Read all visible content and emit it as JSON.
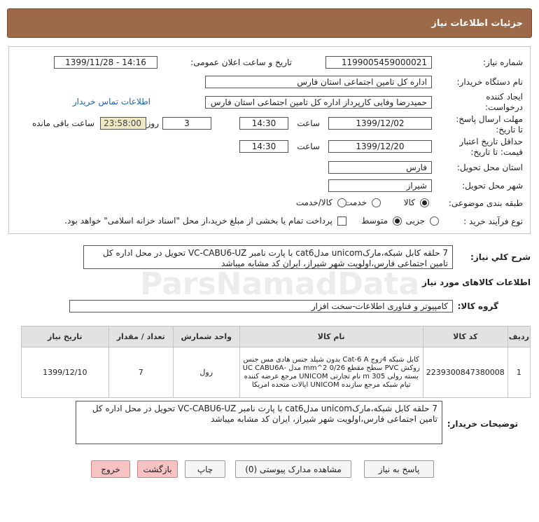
{
  "header": {
    "title": "جزئیات اطلاعات نیاز"
  },
  "fields": {
    "need_number_label": "شماره نیاز:",
    "need_number": "1199005459000021",
    "announce_label": "تاریخ و ساعت اعلان عمومی:",
    "announce_value": "1399/11/28 - 14:16",
    "buyer_org_label": "نام دستگاه خریدار:",
    "buyer_org": "اداره کل تامین اجتماعی استان فارس",
    "creator_label_1": "ایجاد کننده",
    "creator_label_2": "درخواست:",
    "creator": "حمیدرضا وفایی کارپرداز اداره کل تامین اجتماعی استان فارس",
    "contact_link": "اطلاعات تماس خریدار",
    "deadline_label_1": "مهلت ارسال پاسخ:",
    "deadline_label_2": "تا تاریخ:",
    "deadline_date": "1399/12/02",
    "time_label": "ساعت",
    "deadline_time": "14:30",
    "days": "3",
    "days_label": "روز و",
    "remaining_time": "23:58:00",
    "remaining_label": "ساعت باقی مانده",
    "validity_label_1": "حداقل تاریخ اعتبار",
    "validity_label_2": "قیمت: تا تاریخ:",
    "validity_date": "1399/12/20",
    "validity_time": "14:30",
    "province_label": "استان محل تحویل:",
    "province": "فارس",
    "city_label": "شهر محل تحویل:",
    "city": "شیراز",
    "category_label": "طبقه بندی موضوعی:",
    "category_options": [
      "کالا",
      "خدمت",
      "کالا/خدمت"
    ],
    "process_label": "نوع فرآیند خرید :",
    "process_options": [
      "جزیی",
      "متوسط"
    ],
    "payment_note": "پرداخت تمام یا بخشی از مبلغ خرید،از محل \"اسناد خزانه اسلامی\" خواهد بود."
  },
  "summary": {
    "label": "شرح کلي نياز:",
    "text": "7 حلقه کابل شبکه،مارکunicom مدلcat6 با پارت نامبر VC-CABU6-UZ تحویل در محل اداره کل تامین اجتماعی فارس،اولویت شهر شیراز، ایران کد مشابه میباشد"
  },
  "goods_section": {
    "title": "اطلاعات کالاهای مورد نیاز"
  },
  "group": {
    "label": "گروه کالا:",
    "value": "کامپیوتر و فناوری اطلاعات-سخت افزار"
  },
  "table": {
    "headers": [
      "ردیف",
      "کد کالا",
      "نام کالا",
      "واحد شمارش",
      "تعداد / مقدار",
      "تاریخ نیاز"
    ],
    "rows": [
      {
        "row": "1",
        "code": "2239300847380008",
        "name": "کابل شبکه 4زوج Cat-6 A بدون شیلد جنس هادی مس جنس روکش PVC سطح مقطع 0/26 mm^2 مدل -UC CABU6A بسته رولی 305 m نام تجارتی UNICOM مرجع عرضه کننده تیام شبکه مرجع سازنده UNICOM ایالات متحده امریکا",
        "unit": "رول",
        "qty": "7",
        "date": "1399/12/10"
      }
    ]
  },
  "buyer_notes": {
    "label": "توضیحات خریدار:",
    "text": "7 حلقه کابل شبکه،مارکunicom مدلcat6 با پارت نامبر VC-CABU6-UZ تحویل در محل اداره کل تامین اجتماعی فارس،اولویت شهر شیراز، ایران کد مشابه میباشد"
  },
  "buttons": {
    "reply": "پاسخ به نیاز",
    "attachments": "مشاهده مدارک پیوستی (0)",
    "print": "چاپ",
    "back": "بازگشت",
    "exit": "خروج"
  },
  "watermark": {
    "text": "ParsNamadData"
  }
}
